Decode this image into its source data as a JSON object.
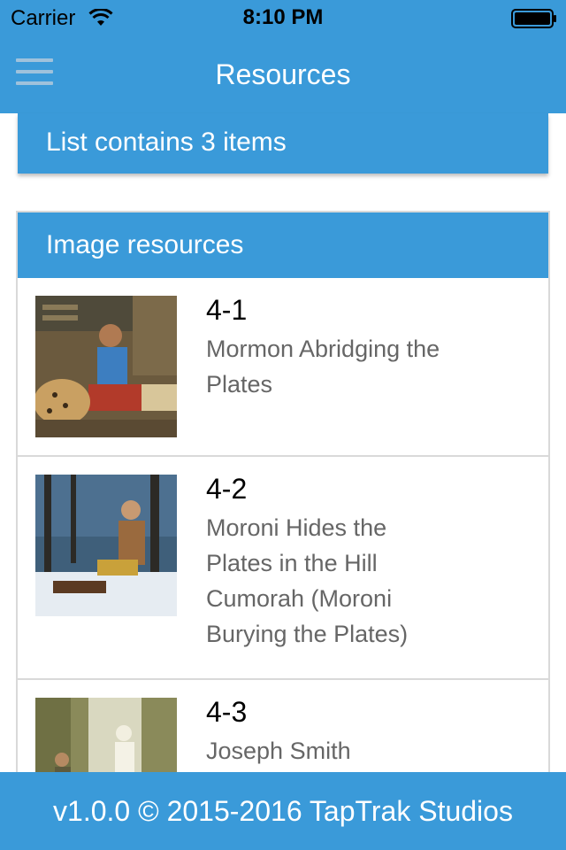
{
  "status_bar": {
    "carrier": "Carrier",
    "time": "8:10 PM",
    "wifi_icon": "wifi-icon",
    "battery_icon": "battery-icon"
  },
  "nav": {
    "title": "Resources",
    "menu_icon": "hamburger-menu-icon"
  },
  "summary": {
    "text": "List contains 3 items"
  },
  "list": {
    "header": "Image resources",
    "items": [
      {
        "code": "4-1",
        "title": "Mormon Abridging the Plates",
        "thumbnail": "painting-thumbnail"
      },
      {
        "code": "4-2",
        "title": "Moroni Hides the Plates in the Hill Cumorah (Moroni Burying the Plates)",
        "thumbnail": "painting-thumbnail"
      },
      {
        "code": "4-3",
        "title": "Joseph Smith",
        "thumbnail": "painting-thumbnail"
      }
    ]
  },
  "footer": {
    "text": "v1.0.0 © 2015-2016 TapTrak Studios"
  },
  "colors": {
    "accent": "#3a9ad9",
    "secondary_text": "#666666",
    "divider": "#d9d9d9"
  }
}
